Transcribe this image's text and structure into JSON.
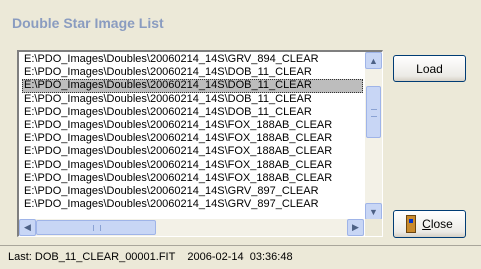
{
  "window": {
    "title": "Double Star Image List"
  },
  "list": {
    "items": [
      "E:\\PDO_Images\\Doubles\\20060214_14S\\GRV_894_CLEAR",
      "E:\\PDO_Images\\Doubles\\20060214_14S\\DOB_11_CLEAR",
      "E:\\PDO_Images\\Doubles\\20060214_14S\\DOB_11_CLEAR",
      "E:\\PDO_Images\\Doubles\\20060214_14S\\DOB_11_CLEAR",
      "E:\\PDO_Images\\Doubles\\20060214_14S\\DOB_11_CLEAR",
      "E:\\PDO_Images\\Doubles\\20060214_14S\\FOX_188AB_CLEAR",
      "E:\\PDO_Images\\Doubles\\20060214_14S\\FOX_188AB_CLEAR",
      "E:\\PDO_Images\\Doubles\\20060214_14S\\FOX_188AB_CLEAR",
      "E:\\PDO_Images\\Doubles\\20060214_14S\\FOX_188AB_CLEAR",
      "E:\\PDO_Images\\Doubles\\20060214_14S\\FOX_188AB_CLEAR",
      "E:\\PDO_Images\\Doubles\\20060214_14S\\GRV_897_CLEAR",
      "E:\\PDO_Images\\Doubles\\20060214_14S\\GRV_897_CLEAR"
    ],
    "selected_index": 2
  },
  "buttons": {
    "load": "Load",
    "close": "Close"
  },
  "status": {
    "text": "Last: DOB_11_CLEAR_00001.FIT    2006-02-14  03:36:48"
  },
  "icons": {
    "scroll_up": "scroll-up-arrow-icon",
    "scroll_down": "scroll-down-arrow-icon",
    "scroll_left": "scroll-left-arrow-icon",
    "scroll_right": "scroll-right-arrow-icon",
    "close": "door-exit-icon"
  }
}
